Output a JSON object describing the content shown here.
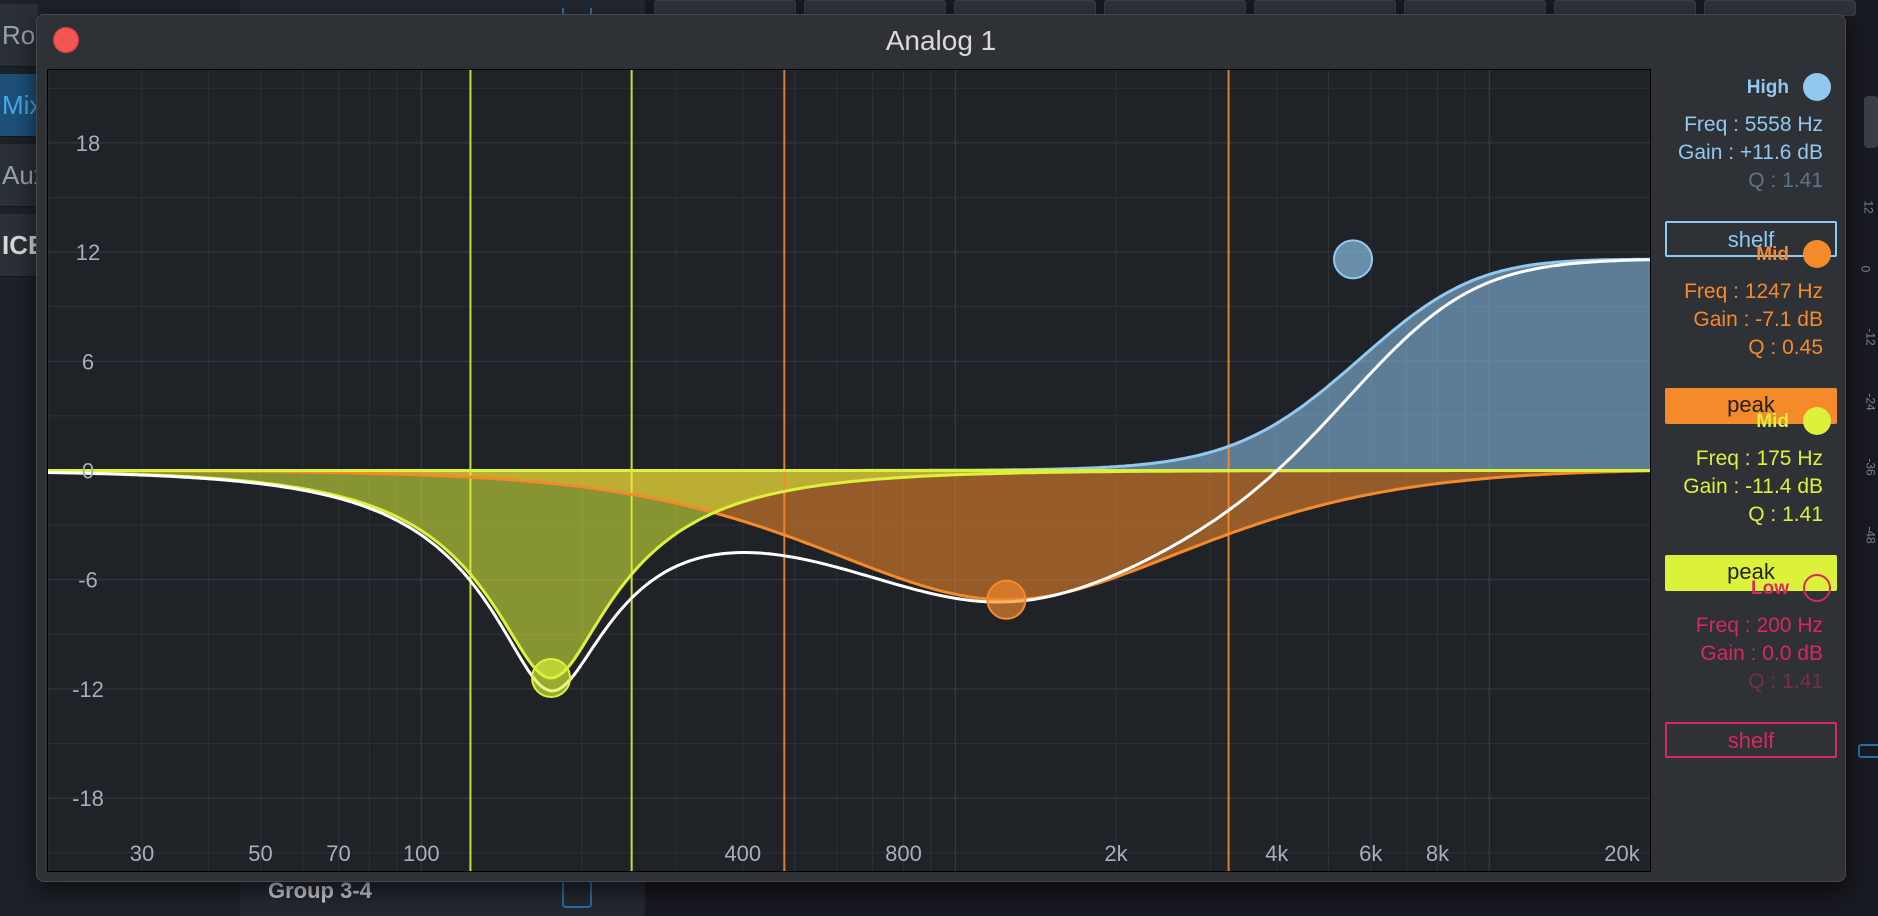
{
  "window": {
    "title": "Analog 1"
  },
  "background": {
    "side_buttons": [
      "Ro",
      "Mix",
      "Aux",
      "ICE"
    ],
    "group_label": "Group 3-4",
    "meter_scale": [
      "12",
      "0",
      "-12",
      "-24",
      "-36",
      "-48"
    ]
  },
  "eq": {
    "y_ticks": [
      "18",
      "12",
      "6",
      "0",
      "-6",
      "-12",
      "-18"
    ],
    "x_ticks": [
      {
        "label": "30",
        "f": 30
      },
      {
        "label": "50",
        "f": 50
      },
      {
        "label": "70",
        "f": 70
      },
      {
        "label": "100",
        "f": 100
      },
      {
        "label": "400",
        "f": 400
      },
      {
        "label": "800",
        "f": 800
      },
      {
        "label": "2k",
        "f": 2000
      },
      {
        "label": "4k",
        "f": 4000
      },
      {
        "label": "6k",
        "f": 6000
      },
      {
        "label": "8k",
        "f": 8000
      },
      {
        "label": "20k",
        "f": 20000
      }
    ],
    "x_range": [
      20,
      20000
    ],
    "y_range": [
      -22,
      22
    ],
    "colors": {
      "high": "#90c8f0",
      "mid_orange": "#f58a2a",
      "mid_yellow": "#dcf23a",
      "low": "#d8285c",
      "sum": "#ffffff"
    }
  },
  "bands": [
    {
      "id": "high",
      "name": "High",
      "color": "#90c8f0",
      "freq_label": "Freq :",
      "freq": "5558 Hz",
      "gain_label": "Gain :",
      "gain": "+11.6 dB",
      "q_label": "Q :",
      "q": "1.41",
      "q_dim": true,
      "type": "shelf",
      "filled": false,
      "enabled": true,
      "freq_hz": 5558,
      "gain_db": 11.6,
      "q_val": 1.41
    },
    {
      "id": "mid-orange",
      "name": "Mid",
      "color": "#f58a2a",
      "freq_label": "Freq :",
      "freq": "1247 Hz",
      "gain_label": "Gain :",
      "gain": "-7.1 dB",
      "q_label": "Q :",
      "q": "0.45",
      "q_dim": false,
      "type": "peak",
      "filled": true,
      "enabled": true,
      "freq_hz": 1247,
      "gain_db": -7.1,
      "q_val": 0.45
    },
    {
      "id": "mid-yellow",
      "name": "Mid",
      "color": "#dcf23a",
      "freq_label": "Freq :",
      "freq": "175 Hz",
      "gain_label": "Gain :",
      "gain": "-11.4 dB",
      "q_label": "Q :",
      "q": "1.41",
      "q_dim": false,
      "type": "peak",
      "filled": true,
      "enabled": true,
      "freq_hz": 175,
      "gain_db": -11.4,
      "q_val": 1.41
    },
    {
      "id": "low",
      "name": "Low",
      "color": "#d8285c",
      "freq_label": "Freq :",
      "freq": "200 Hz",
      "gain_label": "Gain :",
      "gain": "0.0 dB",
      "q_label": "Q :",
      "q": "1.41",
      "q_dim": true,
      "type": "shelf",
      "filled": false,
      "enabled": false,
      "freq_hz": 200,
      "gain_db": 0.0,
      "q_val": 1.41
    }
  ]
}
